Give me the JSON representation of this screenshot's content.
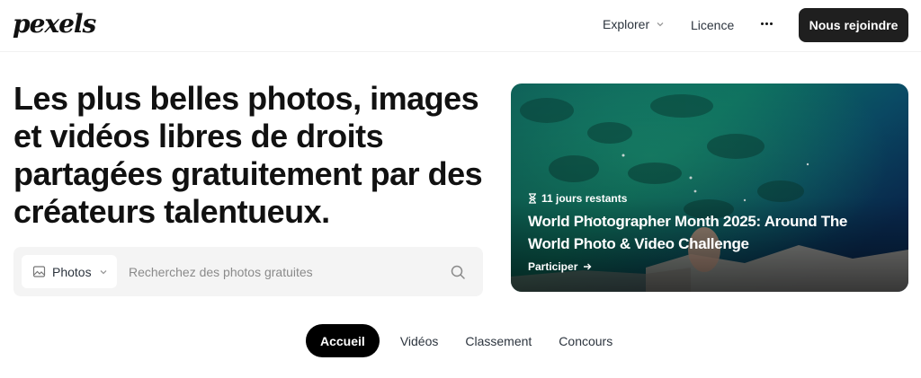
{
  "header": {
    "logo_text": "pexels",
    "explore_label": "Explorer",
    "licence_label": "Licence",
    "join_label": "Nous rejoindre"
  },
  "hero": {
    "title": "Les plus belles photos, images et vidéos libres de droits partagées gratuitement par des créateurs talentueux."
  },
  "search": {
    "type_label": "Photos",
    "placeholder": "Recherchez des photos gratuites",
    "value": ""
  },
  "banner": {
    "days_left": "11 jours restants",
    "title": "World Photographer Month 2025: Around The World Photo & Video Challenge",
    "cta": "Participer"
  },
  "tabs": [
    {
      "label": "Accueil",
      "active": true
    },
    {
      "label": "Vidéos",
      "active": false
    },
    {
      "label": "Classement",
      "active": false
    },
    {
      "label": "Concours",
      "active": false
    }
  ],
  "colors": {
    "primary_button": "#1f1f1f",
    "active_tab": "#000000",
    "search_bg": "#f4f4f4"
  },
  "icons": {
    "search_type": "image-icon",
    "search": "search-icon",
    "more": "more-dots-icon",
    "hourglass": "hourglass-icon",
    "arrow": "arrow-right-icon"
  }
}
